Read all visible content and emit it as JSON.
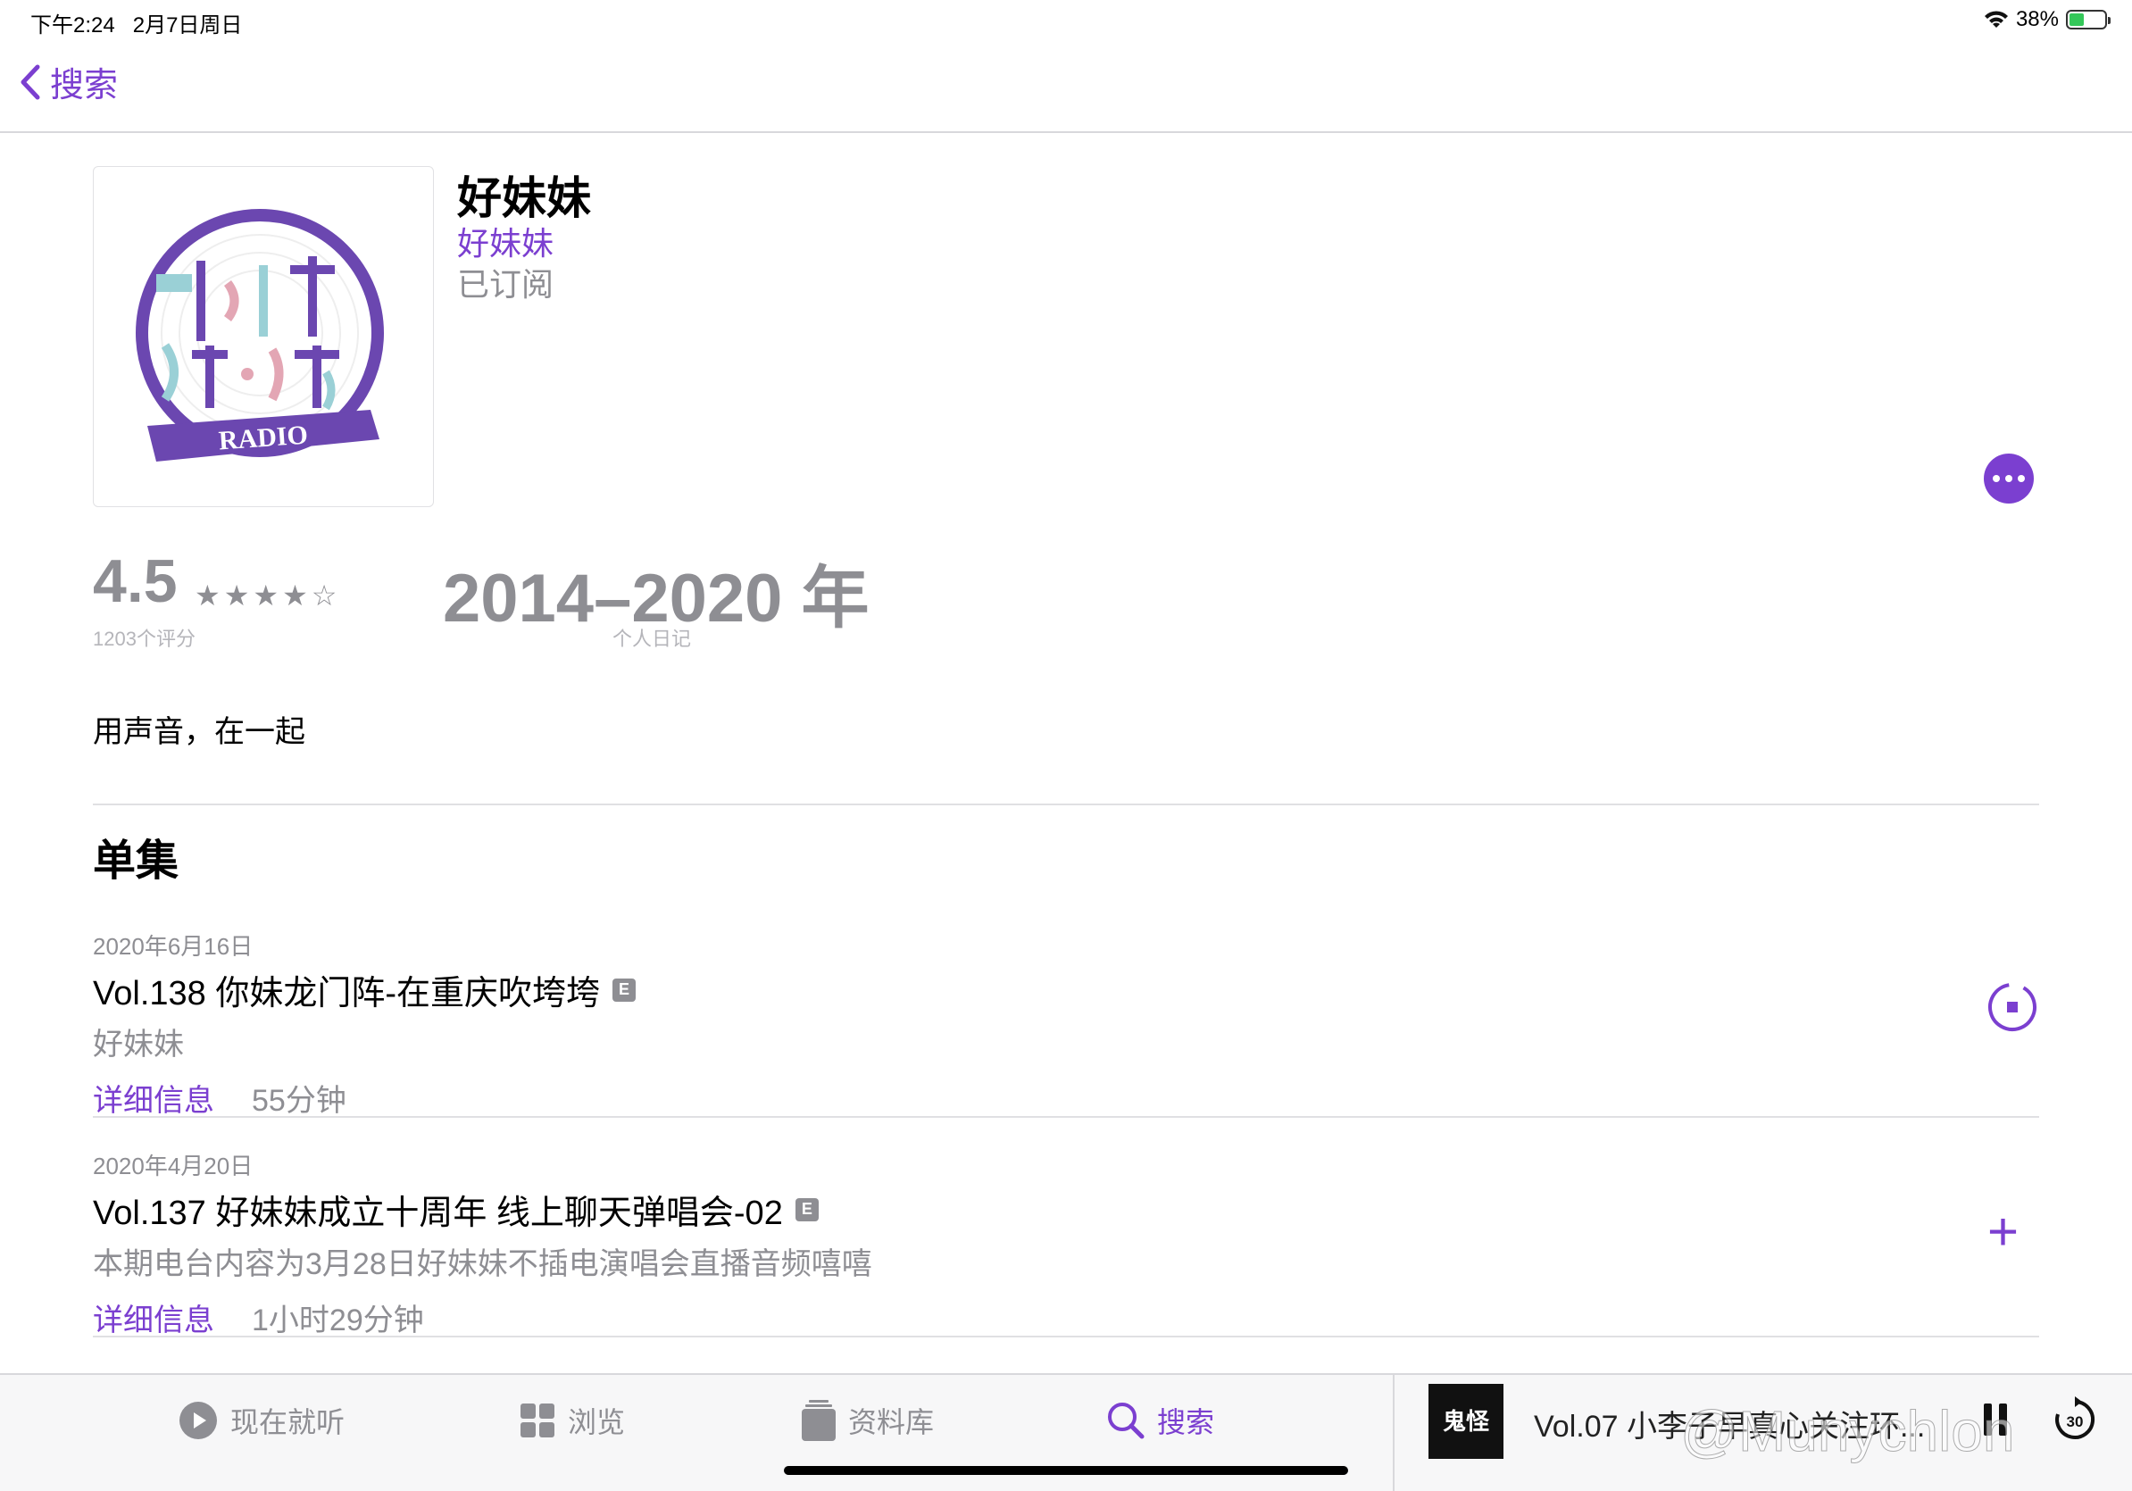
{
  "status_bar": {
    "time": "下午2:24",
    "date": "2月7日周日",
    "battery": "38%"
  },
  "nav": {
    "back_label": "搜索"
  },
  "podcast": {
    "artwork_text": "RADIO",
    "title": "好妹妹",
    "author": "好妹妹",
    "status": "已订阅",
    "rating": "4.5",
    "stars": "★★★★☆",
    "rating_count": "1203个评分",
    "years": "2014–2020 年",
    "category": "个人日记",
    "description": "用声音，在一起"
  },
  "episodes_section": {
    "title": "单集"
  },
  "episodes": [
    {
      "date": "2020年6月16日",
      "title": "Vol.138 你妹龙门阵-在重庆吹垮垮",
      "explicit": "E",
      "subtitle": "好妹妹",
      "details_label": "详细信息",
      "duration": "55分钟"
    },
    {
      "date": "2020年4月20日",
      "title": "Vol.137 好妹妹成立十周年 线上聊天弹唱会-02",
      "explicit": "E",
      "subtitle": "本期电台内容为3月28日好妹妹不插电演唱会直播音频嘻嘻",
      "details_label": "详细信息",
      "duration": "1小时29分钟",
      "action": "+"
    }
  ],
  "tabs": [
    {
      "label": "现在就听",
      "icon": "play-circle-icon"
    },
    {
      "label": "浏览",
      "icon": "grid-icon"
    },
    {
      "label": "资料库",
      "icon": "library-icon"
    },
    {
      "label": "搜索",
      "icon": "search-icon"
    }
  ],
  "mini_player": {
    "title": "Vol.07 小李子早真心关注环...",
    "skip_seconds": "30",
    "artwork_text": "鬼怪"
  },
  "watermark": "@Munychlon",
  "colors": {
    "accent": "#7b3fd0",
    "secondary": "#8e8e93"
  }
}
